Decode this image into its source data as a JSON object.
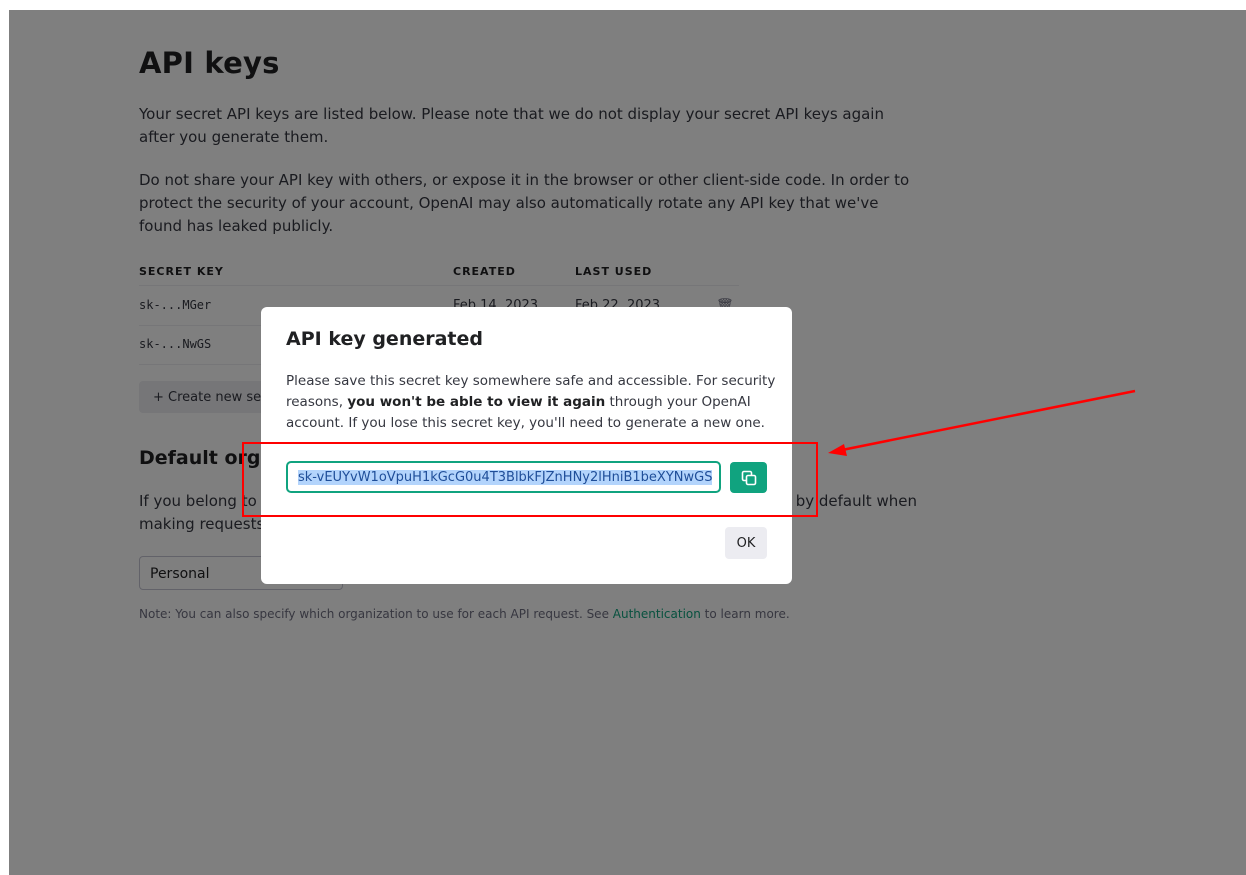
{
  "page": {
    "title": "API keys",
    "intro_1": "Your secret API keys are listed below. Please note that we do not display your secret API keys again after you generate them.",
    "intro_2": "Do not share your API key with others, or expose it in the browser or other client-side code. In order to protect the security of your account, OpenAI may also automatically rotate any API key that we've found has leaked publicly."
  },
  "keys_table": {
    "headers": {
      "secret_key": "SECRET KEY",
      "created": "CREATED",
      "last_used": "LAST USED"
    },
    "rows": [
      {
        "key": "sk-...MGer",
        "created": "Feb 14, 2023",
        "last_used": "Feb 22, 2023"
      },
      {
        "key": "sk-...NwGS",
        "created": "",
        "last_used": ""
      }
    ],
    "create_label": "+ Create new secret key"
  },
  "default_org": {
    "title": "Default organization",
    "text": "If you belong to multiple organizations, this setting controls which organization is used by default when making requests with the API keys above.",
    "selected": "Personal",
    "note_prefix": "Note: You can also specify which organization to use for each API request. See ",
    "note_link": "Authentication",
    "note_suffix": " to learn more."
  },
  "modal": {
    "title": "API key generated",
    "desc_1": "Please save this secret key somewhere safe and accessible. For security reasons, ",
    "desc_bold": "you won't be able to view it again",
    "desc_2": " through your OpenAI account. If you lose this secret key, you'll need to generate a new one.",
    "key_value": "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",
    "ok_label": "OK"
  },
  "colors": {
    "accent": "#10a37f",
    "annotation": "#ff0000",
    "selection": "#b3d4fc"
  }
}
